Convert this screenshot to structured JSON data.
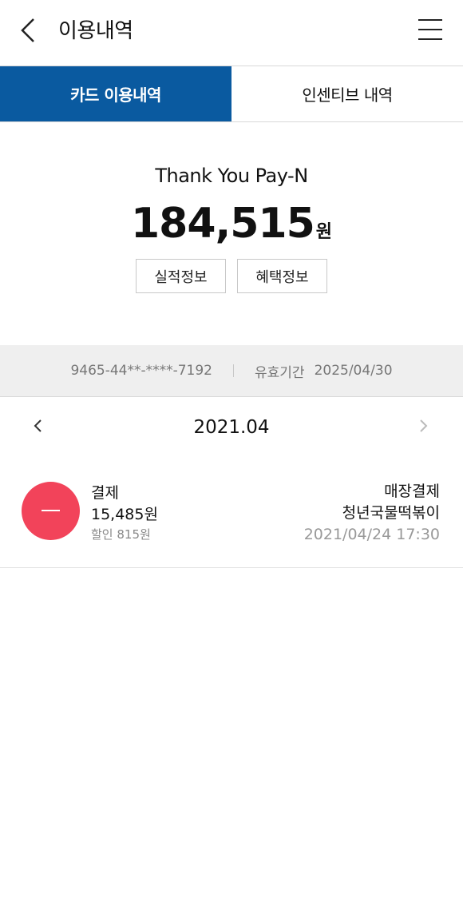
{
  "header": {
    "title": "이용내역",
    "back_icon": "chevron-left-icon",
    "menu_icon": "hamburger-menu-icon"
  },
  "tabs": [
    {
      "label": "카드 이용내역",
      "active": true
    },
    {
      "label": "인센티브 내역",
      "active": false
    }
  ],
  "card": {
    "name": "Thank You Pay-N",
    "amount": "184,515",
    "unit": "원",
    "buttons": [
      "실적정보",
      "혜택정보"
    ],
    "number": "9465-44**-****-7192",
    "expiry_label": "유효기간",
    "expiry": "2025/04/30"
  },
  "month": {
    "label": "2021.04",
    "prev_icon": "chevron-left-icon",
    "next_icon": "chevron-right-icon"
  },
  "transactions": [
    {
      "type": "결제",
      "amount": "15,485원",
      "discount": "할인 815원",
      "method": "매장결제",
      "store": "청년국물떡볶이",
      "datetime": "2021/04/24 17:30",
      "icon": "minus-icon"
    }
  ],
  "colors": {
    "accent": "#0a5aa0",
    "payment_icon": "#f2435a"
  }
}
